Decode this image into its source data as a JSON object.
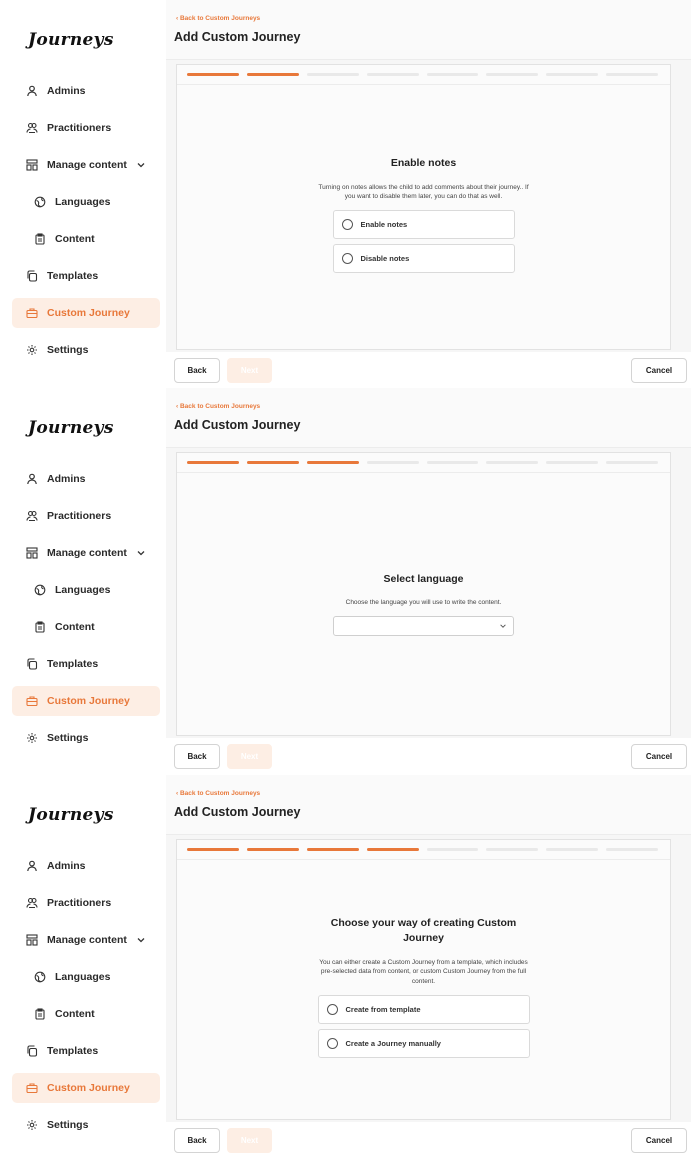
{
  "app": {
    "logo": "Journeys"
  },
  "sidebar": {
    "items": [
      {
        "label": "Admins",
        "icon": "user-icon"
      },
      {
        "label": "Practitioners",
        "icon": "users-icon"
      },
      {
        "label": "Manage content",
        "icon": "layout-icon",
        "expanded": true
      },
      {
        "label": "Languages",
        "icon": "globe-icon",
        "sub": true
      },
      {
        "label": "Content",
        "icon": "clipboard-icon",
        "sub": true
      },
      {
        "label": "Templates",
        "icon": "copy-icon"
      },
      {
        "label": "Custom Journey",
        "icon": "briefcase-icon",
        "active": true
      },
      {
        "label": "Settings",
        "icon": "gear-icon"
      }
    ]
  },
  "header": {
    "back_link": "Back to Custom Journeys",
    "title": "Add Custom Journey"
  },
  "colors": {
    "accent": "#e8783a",
    "accent_light": "#fdeee4"
  },
  "footer": {
    "back": "Back",
    "next": "Next",
    "cancel": "Cancel"
  },
  "screens": [
    {
      "progress": {
        "total_steps": 8,
        "completed": 2
      },
      "step": {
        "title": "Enable notes",
        "description": "Turning on notes allows the child to add comments about their journey.. If you want to disable them later, you can do that as well.",
        "options": [
          "Enable notes",
          "Disable notes"
        ]
      }
    },
    {
      "progress": {
        "total_steps": 8,
        "completed": 3
      },
      "step": {
        "title": "Select language",
        "description": "Choose the language you will use to write the content.",
        "select_value": ""
      }
    },
    {
      "progress": {
        "total_steps": 8,
        "completed": 4
      },
      "step": {
        "title": "Choose your way of creating Custom Journey",
        "description": "You can either create a Custom Journey from a template, which includes pre-selected data from content, or custom Custom Journey from the full content.",
        "options": [
          "Create from template",
          "Create a Journey manually"
        ]
      }
    }
  ]
}
